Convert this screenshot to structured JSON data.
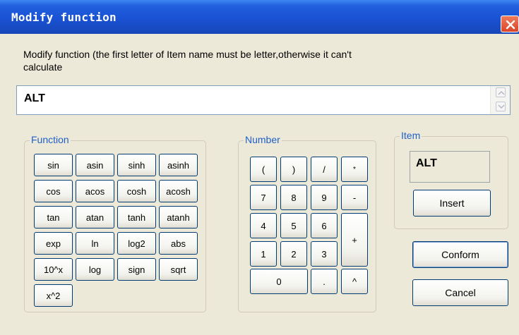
{
  "window": {
    "title": "Modify function",
    "prompt": "Modify function (the first letter of Item name must be letter,otherwise it can't calculate"
  },
  "expression": {
    "value": "ALT"
  },
  "function_group": {
    "legend": "Function",
    "buttons": [
      "sin",
      "asin",
      "sinh",
      "asinh",
      "cos",
      "acos",
      "cosh",
      "acosh",
      "tan",
      "atan",
      "tanh",
      "atanh",
      "exp",
      "ln",
      "log2",
      "abs",
      "10^x",
      "log",
      "sign",
      "sqrt",
      "x^2"
    ]
  },
  "number_group": {
    "legend": "Number",
    "buttons": [
      "(",
      ")",
      "/",
      "*",
      "7",
      "8",
      "9",
      "-",
      "4",
      "5",
      "6",
      "+",
      "1",
      "2",
      "3",
      "0",
      ".",
      "^"
    ]
  },
  "item_group": {
    "legend": "Item",
    "value": "ALT",
    "insert_label": "Insert"
  },
  "actions": {
    "conform_label": "Conform",
    "cancel_label": "Cancel"
  },
  "icons": {
    "close": "close-icon",
    "scroll_up": "chevron-up-icon",
    "scroll_down": "chevron-down-icon"
  }
}
